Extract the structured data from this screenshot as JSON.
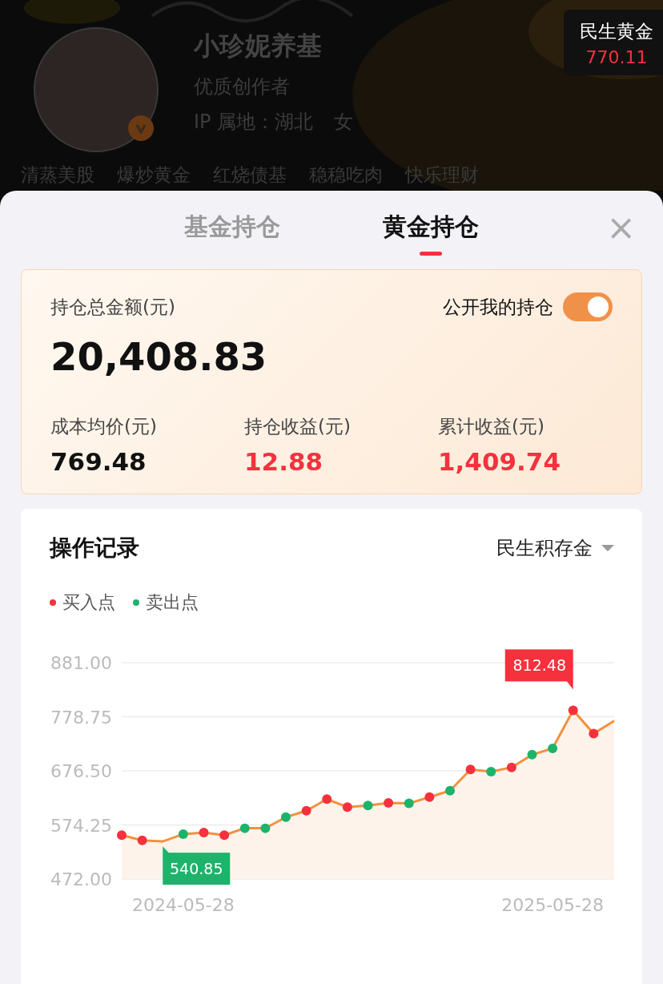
{
  "profile": {
    "name": "小珍妮养基",
    "title": "优质创作者",
    "location": "IP 属地：湖北",
    "gender": "女",
    "verified": true,
    "tags": [
      "清蒸美股",
      "爆炒黄金",
      "红烧债基",
      "稳稳吃肉",
      "快乐理财"
    ]
  },
  "price_badge": {
    "label": "民生黄金",
    "price": "770.11"
  },
  "tabs": [
    {
      "label": "基金持仓",
      "selected": false
    },
    {
      "label": "黄金持仓",
      "selected": true
    }
  ],
  "close": "×",
  "summary": {
    "total_label": "持仓总金额(元)",
    "total": "20,408.83",
    "public_label": "公开我的持仓",
    "public_on": true,
    "stats": [
      {
        "label": "成本均价(元)",
        "value": "769.48",
        "kind": "neutral"
      },
      {
        "label": "持仓收益(元)",
        "value": "12.88",
        "kind": "gain"
      },
      {
        "label": "累计收益(元)",
        "value": "1,409.74",
        "kind": "gain"
      }
    ]
  },
  "records": {
    "title": "操作记录",
    "product": "民生积存金",
    "chart_data": {
      "type": "area",
      "grid": true,
      "categories": [
        null,
        null,
        null,
        "2024-05-28",
        null,
        null,
        null,
        null,
        null,
        null,
        null,
        null,
        null,
        null,
        null,
        null,
        null,
        null,
        null,
        null,
        null,
        "2025-05-28",
        null,
        null,
        null
      ],
      "ylim": [
        472,
        881
      ],
      "yticks": [
        {
          "value": 881,
          "label": "881.00"
        },
        {
          "value": 778.75,
          "label": "778.75"
        },
        {
          "value": 676.5,
          "label": "676.50"
        },
        {
          "value": 574.25,
          "label": "574.25"
        },
        {
          "value": 472,
          "label": "472.00"
        }
      ],
      "series": [
        {
          "type": "area",
          "color": "#f5903d",
          "values": [
            555,
            545,
            543,
            557,
            560,
            555,
            568,
            568,
            589,
            601,
            623,
            608,
            611,
            616,
            615,
            627,
            639,
            679,
            675,
            683,
            707,
            719,
            791,
            747,
            771
          ]
        },
        {
          "name": "买入点",
          "type": "scatter",
          "color": "#f5313d",
          "values": [
            555,
            545,
            null,
            null,
            560,
            555,
            null,
            null,
            null,
            601,
            623,
            608,
            null,
            616,
            null,
            627,
            null,
            679,
            null,
            683,
            null,
            null,
            791,
            747,
            null
          ]
        },
        {
          "name": "卖出点",
          "type": "scatter",
          "color": "#1db36b",
          "values": [
            null,
            null,
            null,
            557,
            null,
            null,
            568,
            568,
            589,
            null,
            null,
            null,
            611,
            null,
            615,
            null,
            639,
            null,
            675,
            null,
            707,
            719,
            null,
            null,
            null
          ]
        }
      ],
      "annotations": [
        "812.48",
        "540.85"
      ]
    }
  }
}
